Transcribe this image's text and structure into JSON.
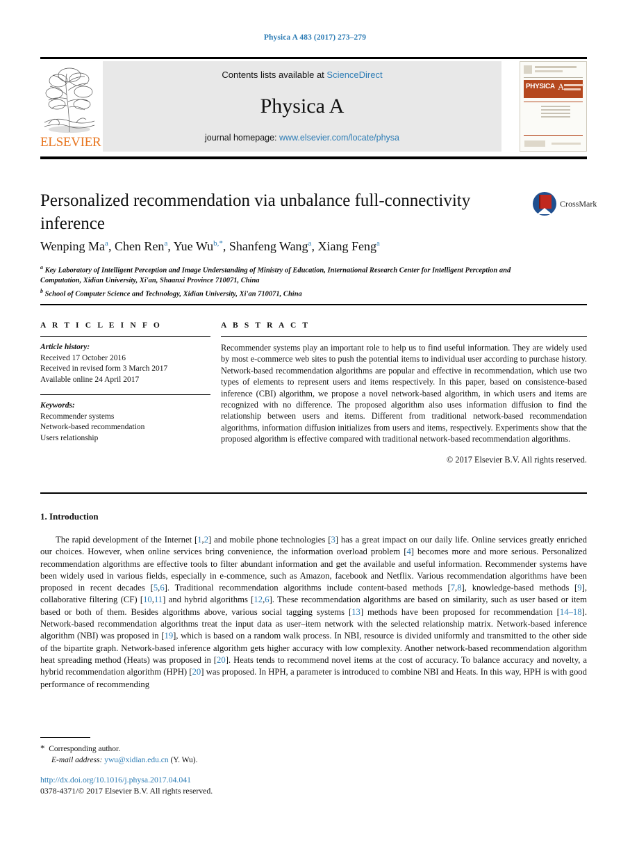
{
  "running_head": "Physica A 483 (2017) 273–279",
  "masthead": {
    "publisher_name": "ELSEVIER",
    "contents_prefix": "Contents lists available at ",
    "contents_link": "ScienceDirect",
    "journal_name": "Physica A",
    "homepage_prefix": "journal homepage: ",
    "homepage_link": "www.elsevier.com/locate/physa",
    "cover": {
      "banner_main": "PHYSICA",
      "banner_letter": "A"
    }
  },
  "article": {
    "title": "Personalized recommendation via unbalance full-connectivity inference",
    "crossmark_label": "CrossMark",
    "authors_html": "Wenping Ma<sup>a</sup>, Chen Ren<sup>a</sup>, Yue Wu<sup>b,*</sup>, Shanfeng Wang<sup>a</sup>, Xiang Feng<sup>a</sup>",
    "affiliation_a": "Key Laboratory of Intelligent Perception and Image Understanding of Ministry of Education, International Research Center for Intelligent Perception and Computation, Xidian University, Xi'an, Shaanxi Province 710071, China",
    "affiliation_b": "School of Computer Science and Technology, Xidian University, Xi'an 710071, China"
  },
  "info": {
    "heading": "A R T I C L E   I N F O",
    "history_label": "Article history:",
    "received": "Received 17 October 2016",
    "revised": "Received in revised form 3 March 2017",
    "available": "Available online 24 April 2017",
    "keywords_label": "Keywords:",
    "keywords": [
      "Recommender systems",
      "Network-based recommendation",
      "Users relationship"
    ]
  },
  "abstract": {
    "heading": "A B S T R A C T",
    "text": "Recommender systems play an important role to help us to find useful information. They are widely used by most e-commerce web sites to push the potential items to individual user according to purchase history. Network-based recommendation algorithms are popular and effective in recommendation, which use two types of elements to represent users and items respectively. In this paper, based on consistence-based inference (CBI) algorithm, we propose a novel network-based algorithm, in which users and items are recognized with no difference. The proposed algorithm also uses information diffusion to find the relationship between users and items. Different from traditional network-based recommendation algorithms, information diffusion initializes from users and items, respectively. Experiments show that the proposed algorithm is effective compared with traditional network-based recommendation algorithms.",
    "copyright": "© 2017 Elsevier B.V. All rights reserved."
  },
  "body": {
    "section_heading": "1. Introduction",
    "paragraph_html": "The rapid development of the Internet [<span class=\"cite\">1</span>,<span class=\"cite\">2</span>] and mobile phone technologies [<span class=\"cite\">3</span>] has a great impact on our daily life. Online services greatly enriched our choices. However, when online services bring convenience, the information overload problem [<span class=\"cite\">4</span>] becomes more and more serious. Personalized recommendation algorithms are effective tools to filter abundant information and get the available and useful information. Recommender systems have been widely used in various fields, especially in e-commence, such as Amazon, facebook and Netflix. Various recommendation algorithms have been proposed in recent decades [<span class=\"cite\">5</span>,<span class=\"cite\">6</span>]. Traditional recommendation algorithms include content-based methods [<span class=\"cite\">7</span>,<span class=\"cite\">8</span>], knowledge-based methods [<span class=\"cite\">9</span>], collaborative filtering (CF) [<span class=\"cite\">10</span>,<span class=\"cite\">11</span>] and hybrid algorithms [<span class=\"cite\">12</span>,<span class=\"cite\">6</span>]. These recommendation algorithms are based on similarity, such as user based or item based or both of them. Besides algorithms above, various social tagging systems [<span class=\"cite\">13</span>] methods have been proposed for recommendation [<span class=\"cite\">14–18</span>]. Network-based recommendation algorithms treat the input data as user–item network with the selected relationship matrix. Network-based inference algorithm (NBI) was proposed in [<span class=\"cite\">19</span>], which is based on a random walk process. In NBI, resource is divided uniformly and transmitted to the other side of the bipartite graph. Network-based inference algorithm gets higher accuracy with low complexity. Another network-based recommendation algorithm heat spreading method (Heats) was proposed in [<span class=\"cite\">20</span>]. Heats tends to recommend novel items at the cost of accuracy. To balance accuracy and novelty, a hybrid recommendation algorithm (HPH) [<span class=\"cite\">20</span>] was proposed. In HPH, a parameter is introduced to combine NBI and Heats. In this way, HPH is with good performance of recommending"
  },
  "footer": {
    "corresponding_author": "Corresponding author.",
    "email_label": "E-mail address:",
    "email": "ywu@xidian.edu.cn",
    "email_suffix": "(Y. Wu).",
    "doi": "http://dx.doi.org/10.1016/j.physa.2017.04.041",
    "issn": "0378-4371/© 2017 Elsevier B.V. All rights reserved."
  },
  "colors": {
    "link_blue": "#2e7db5",
    "elsevier_orange": "#E87722",
    "cover_banner": "#b5481e"
  }
}
